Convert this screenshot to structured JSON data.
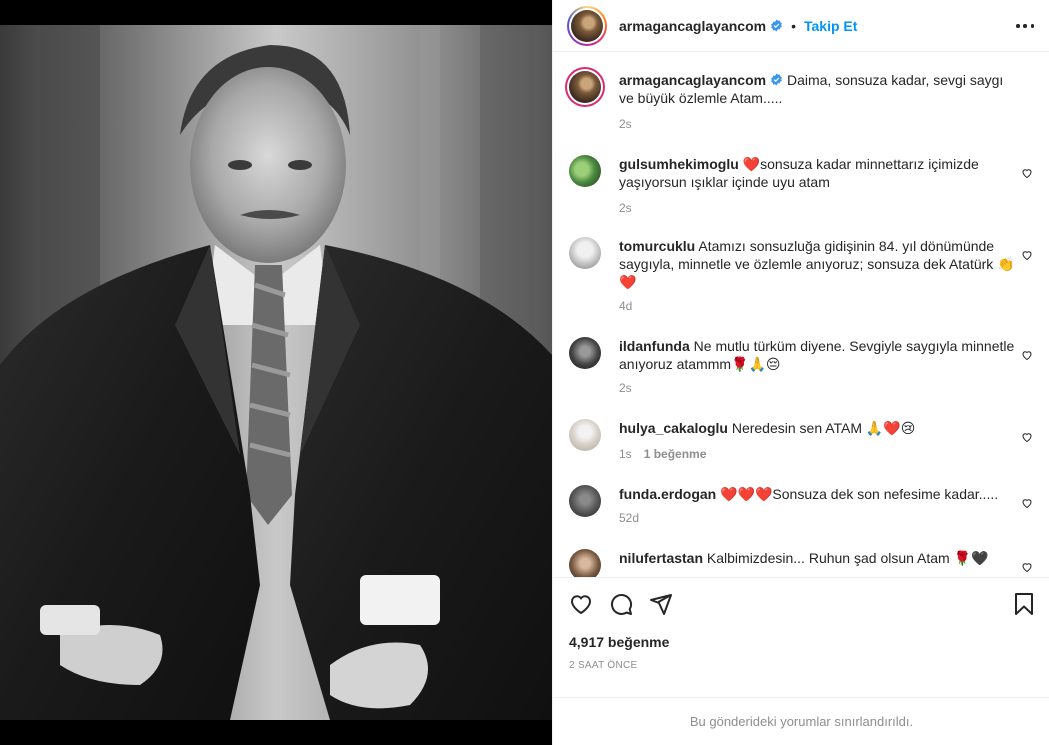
{
  "post": {
    "author": "armagancaglayancom",
    "follow_label": "Takip Et",
    "separator": "•",
    "caption": "Daima, sonsuza kadar, sevgi saygı ve büyük özlemle Atam.....",
    "caption_time": "2s"
  },
  "comments": [
    {
      "username": "gulsumhekimoglu",
      "text": "❤️sonsuza kadar minnettarız içimizde yaşıyorsun ışıklar içinde uyu atam",
      "time": "2s",
      "likes": ""
    },
    {
      "username": "tomurcuklu",
      "text": "Atamızı sonsuzluğa gidişinin 84. yıl dönümünde saygıyla, minnetle ve özlemle anıyoruz; sonsuza dek Atatürk 👏❤️",
      "time": "4d",
      "likes": ""
    },
    {
      "username": "ildanfunda",
      "text": "Ne mutlu türküm diyene. Sevgiyle saygıyla minnetle anıyoruz atammm🌹🙏😔",
      "time": "2s",
      "likes": ""
    },
    {
      "username": "hulya_cakaloglu",
      "text": "Neredesin sen ATAM 🙏❤️😢",
      "time": "1s",
      "likes": "1 beğenme"
    },
    {
      "username": "funda.erdogan",
      "text": "❤️❤️❤️Sonsuza dek son nefesime kadar.....",
      "time": "52d",
      "likes": ""
    },
    {
      "username": "nilufertastan",
      "text": "Kalbimizdesin... Ruhun şad olsun Atam 🌹🖤",
      "time": "",
      "likes": ""
    }
  ],
  "stats": {
    "likes": "4,917 beğenme",
    "posted": "2 SAAT ÖNCE"
  },
  "footer": {
    "restricted": "Bu gönderideki yorumlar sınırlandırıldı."
  },
  "colors": {
    "accent": "#0095f6",
    "text": "#262626",
    "muted": "#8e8e8e",
    "verified": "#3897f0"
  },
  "icons": [
    "verified-badge-icon",
    "more-options-icon",
    "heart-icon",
    "comment-icon",
    "share-icon",
    "bookmark-icon"
  ]
}
